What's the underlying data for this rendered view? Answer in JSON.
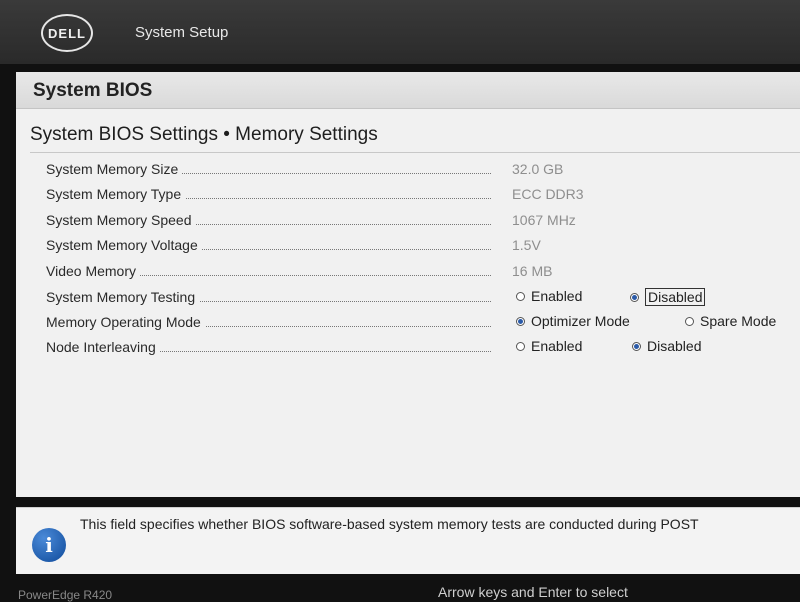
{
  "header": {
    "logo": "DELL",
    "app_title": "System Setup"
  },
  "panel": {
    "title": "System BIOS",
    "section_title": "System BIOS Settings • Memory Settings"
  },
  "settings": [
    {
      "label": "System Memory Size",
      "value": "32.0 GB"
    },
    {
      "label": "System Memory Type",
      "value": "ECC DDR3"
    },
    {
      "label": "System Memory Speed",
      "value": "1067 MHz"
    },
    {
      "label": "System Memory Voltage",
      "value": "1.5V"
    },
    {
      "label": "Video Memory",
      "value": "16 MB"
    },
    {
      "label": "System Memory Testing",
      "options": [
        "Enabled",
        "Disabled"
      ],
      "selected": "Disabled"
    },
    {
      "label": "Memory Operating Mode",
      "options": [
        "Optimizer Mode",
        "Spare Mode"
      ],
      "selected": "Optimizer Mode"
    },
    {
      "label": "Node Interleaving",
      "options": [
        "Enabled",
        "Disabled"
      ],
      "selected": "Disabled"
    }
  ],
  "help": {
    "text": "This field specifies whether BIOS software-based system memory tests are conducted during POST"
  },
  "footer": {
    "model": "PowerEdge R420",
    "hint": "Arrow keys and Enter to select"
  },
  "colors": {
    "accent": "#2a5aa8",
    "info_icon": "#1a5bb0"
  }
}
